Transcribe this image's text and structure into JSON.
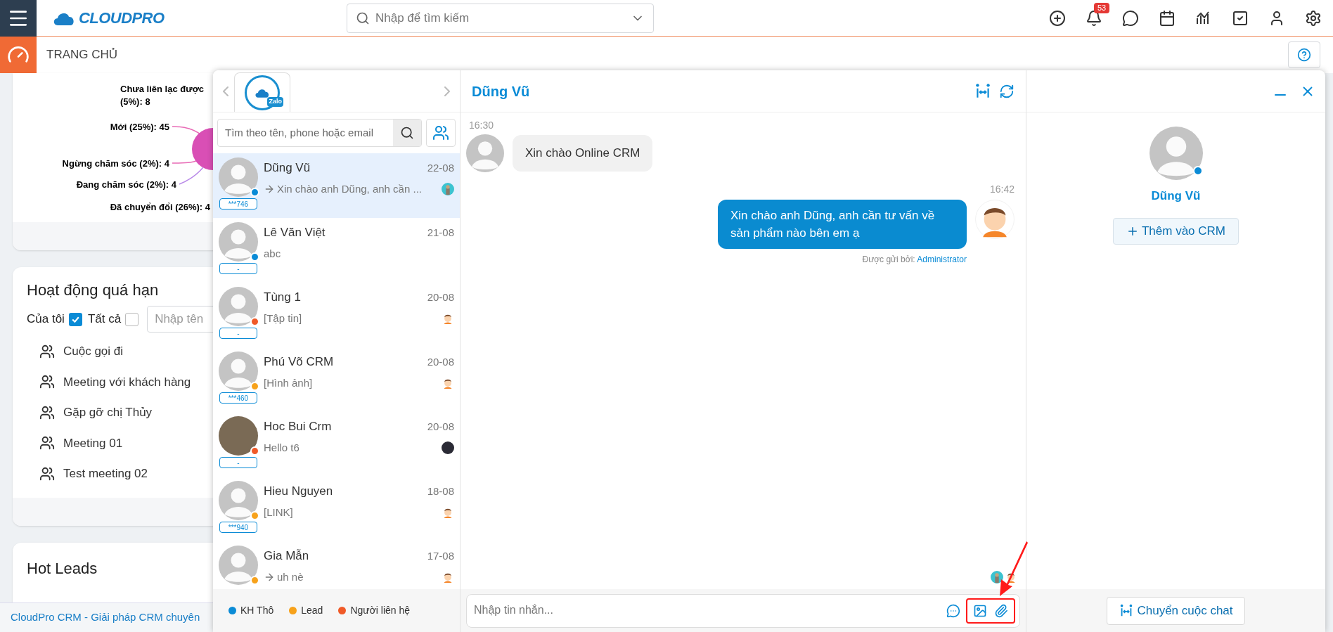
{
  "header": {
    "logo_text": "CLOUDPRO",
    "search_placeholder": "Nhập để tìm kiếm",
    "notification_count": "53"
  },
  "breadcrumb": {
    "title": "TRANG CHỦ"
  },
  "chart_card": {
    "labels": [
      "Chưa liên lạc được (5%): 8",
      "Mới (25%): 45",
      "Ngừng chăm sóc (2%): 4",
      "Đang chăm sóc (2%): 4",
      "Đã chuyển đổi (26%): 4"
    ]
  },
  "overdue_card": {
    "title": "Hoạt động quá hạn",
    "filters": [
      {
        "label": "Của tôi",
        "checked": true
      },
      {
        "label": "Tất cả",
        "checked": false
      }
    ],
    "name_placeholder": "Nhập tên",
    "items": [
      "Cuộc gọi đi",
      "Meeting với khách hàng",
      "Gặp gỡ chị Thủy",
      "Meeting 01",
      "Test meeting 02"
    ]
  },
  "hot_leads_card": {
    "title": "Hot Leads"
  },
  "footer": {
    "text": "CloudPro CRM - Giải pháp CRM chuyên"
  },
  "chat_popup": {
    "channel_tab": {
      "badge": "Zalo",
      "selected": true
    },
    "search_placeholder": "Tìm theo tên, phone hoặc email",
    "contacts": [
      {
        "name": "Dũng Vũ",
        "date": "22-08",
        "outgoing": true,
        "preview": "Xin chào anh Dũng, anh cần ...",
        "tag": "***746",
        "color": "#0a8bd6",
        "photo": false,
        "seen_by": {
          "kind": "teal"
        },
        "selected": true
      },
      {
        "name": "Lê Văn Việt",
        "date": "21-08",
        "outgoing": false,
        "preview": "abc",
        "tag": "-",
        "color": "#0a8bd6",
        "photo": false,
        "selected": false
      },
      {
        "name": "Tùng 1",
        "date": "20-08",
        "outgoing": false,
        "preview": "[Tập tin]",
        "tag": "-",
        "color": "#f05a28",
        "photo": false,
        "seen_by": {
          "kind": "cartoon"
        },
        "selected": false
      },
      {
        "name": "Phú Võ CRM",
        "date": "20-08",
        "outgoing": false,
        "preview": "[Hình ảnh]",
        "tag": "***460",
        "color": "#f7a21b",
        "photo": false,
        "seen_by": {
          "kind": "cartoon"
        },
        "selected": false
      },
      {
        "name": "Hoc Bui Crm",
        "date": "20-08",
        "outgoing": false,
        "preview": "Hello t6",
        "tag": "-",
        "color": "#f05a28",
        "photo": true,
        "seen_by": {
          "kind": "photo"
        },
        "selected": false
      },
      {
        "name": "Hieu Nguyen",
        "date": "18-08",
        "outgoing": false,
        "preview": "[LINK]",
        "tag": "***940",
        "color": "#f7a21b",
        "photo": false,
        "seen_by": {
          "kind": "cartoon"
        },
        "selected": false
      },
      {
        "name": "Gia Mẫn",
        "date": "17-08",
        "outgoing": true,
        "preview": "uh nè",
        "color": "#f7a21b",
        "photo": false,
        "seen_by": {
          "kind": "cartoon"
        },
        "selected": false
      }
    ],
    "legend": [
      {
        "label": "KH Thô",
        "color": "#0a8bd6"
      },
      {
        "label": "Lead",
        "color": "#f7a21b"
      },
      {
        "label": "Người liên hệ",
        "color": "#f05a28"
      }
    ],
    "conversation": {
      "title": "Dũng Vũ",
      "messages": [
        {
          "kind": "incoming",
          "time": "16:30",
          "text": "Xin chào Online CRM"
        },
        {
          "kind": "outgoing",
          "time": "16:42",
          "text": "Xin chào anh Dũng, anh cần tư vấn về sản phẩm nào bên em ạ",
          "sender_label": "Được gửi bởi:",
          "sender": "Administrator"
        }
      ],
      "input_placeholder": "Nhập tin nhắn..."
    },
    "profile": {
      "name": "Dũng Vũ",
      "color": "#0a8bd6",
      "add_button": "Thêm vào CRM",
      "transfer_button": "Chuyển cuộc chat"
    }
  }
}
